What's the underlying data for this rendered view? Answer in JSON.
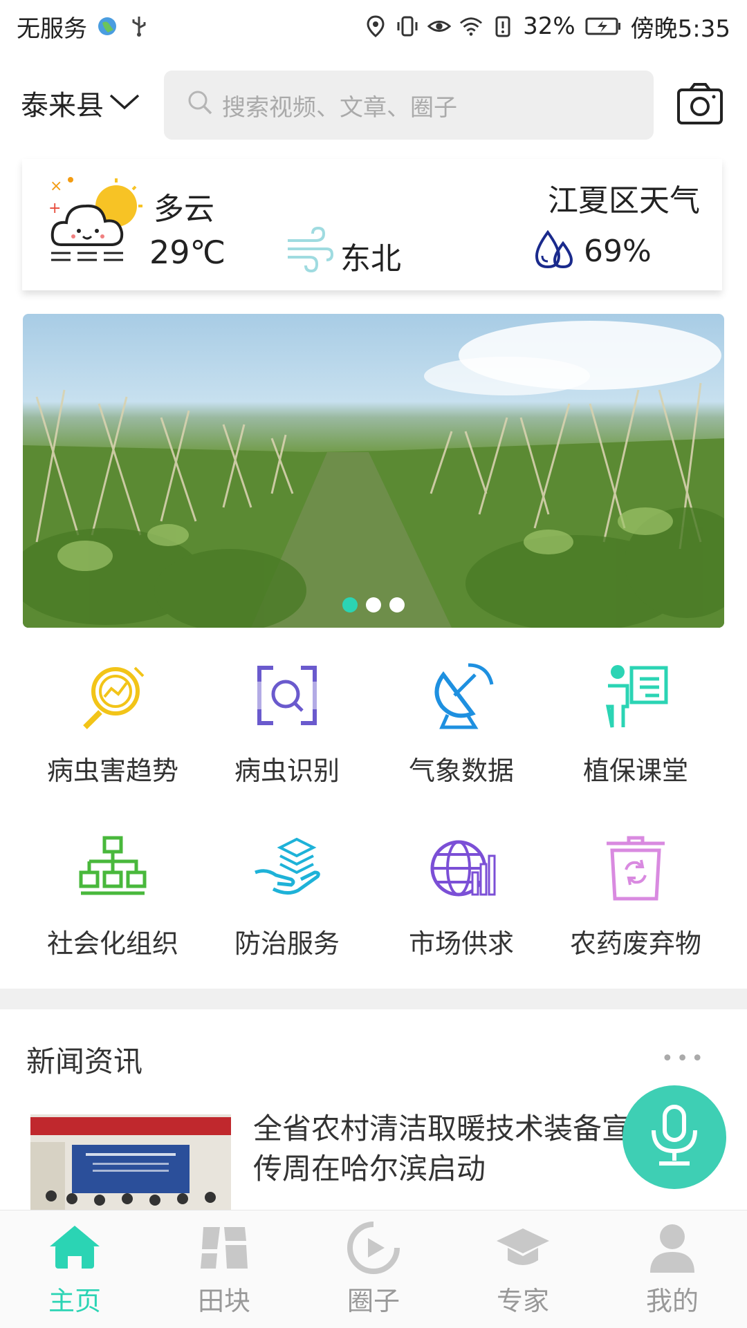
{
  "status_bar": {
    "carrier": "无服务",
    "battery": "32%",
    "time": "傍晚5:35"
  },
  "header": {
    "location": "泰来县",
    "search_placeholder": "搜索视频、文章、圈子"
  },
  "weather": {
    "title": "江夏区天气",
    "condition": "多云",
    "temperature": "29℃",
    "wind": "东北",
    "humidity": "69%"
  },
  "banner": {
    "dots": 3,
    "active_dot": 0
  },
  "services": [
    {
      "label": "病虫害趋势",
      "icon": "trend-magnifier-icon",
      "color": "#f2c418"
    },
    {
      "label": "病虫识别",
      "icon": "scan-identify-icon",
      "color": "#6a5acd"
    },
    {
      "label": "气象数据",
      "icon": "satellite-dish-icon",
      "color": "#1e90e0"
    },
    {
      "label": "植保课堂",
      "icon": "classroom-icon",
      "color": "#2bd4b4"
    },
    {
      "label": "社会化组织",
      "icon": "org-chart-icon",
      "color": "#49b83c"
    },
    {
      "label": "防治服务",
      "icon": "hand-service-icon",
      "color": "#1eb2d8"
    },
    {
      "label": "市场供求",
      "icon": "globe-market-icon",
      "color": "#7b4fd6"
    },
    {
      "label": "农药废弃物",
      "icon": "recycle-bin-icon",
      "color": "#d98ae0"
    }
  ],
  "news": {
    "section_title": "新闻资讯",
    "more": "•••",
    "items": [
      {
        "headline": "全省农村清洁取暖技术装备宣传周在哈尔滨启动"
      }
    ]
  },
  "tabs": [
    {
      "label": "主页",
      "icon": "home-icon",
      "active": true
    },
    {
      "label": "田块",
      "icon": "field-icon",
      "active": false
    },
    {
      "label": "圈子",
      "icon": "circle-play-icon",
      "active": false
    },
    {
      "label": "专家",
      "icon": "graduation-cap-icon",
      "active": false
    },
    {
      "label": "我的",
      "icon": "user-icon",
      "active": false
    }
  ],
  "colors": {
    "accent": "#2bd4b4",
    "mic": "#3ecfb4"
  }
}
